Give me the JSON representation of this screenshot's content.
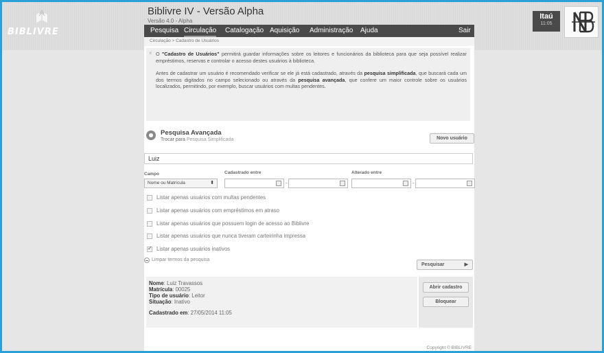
{
  "app": {
    "logo_text": "BIBLIVRE",
    "title": "Biblivre IV - Versão Alpha",
    "version": "Versão 4.0 - Alpha"
  },
  "nav": {
    "items": [
      "Pesquisa",
      "Circulação",
      "Catalogação",
      "Aquisição",
      "Administração",
      "Ajuda"
    ],
    "active": "Circulação",
    "logout": "Sair"
  },
  "breadcrumb": "Circulação > Cadastro de Usuários",
  "bank": {
    "name": "Itaú",
    "time": "11:05"
  },
  "info": {
    "p1_pre": "O ",
    "p1_bold": "\"Cadastro de Usuários\"",
    "p1_post": " permitirá guardar informações sobre os leitores e funcionários da biblioteca para que seja possível realizar empréstimos, reservas e controlar o acesso destes usuários à biblioteca.",
    "p2_a": "Antes de cadastrar um usuário é recomendado verificar se ele já está cadastrado, através da ",
    "p2_b": "pesquisa simplificada",
    "p2_c": ", que buscará cada um dos termos digitados no campo selecionado ou através da ",
    "p2_d": "pesquisa avançada",
    "p2_e": ", que confere um maior controle sobre os usuários localizados, permitindo, por exemplo, buscar usuários com multas pendentes."
  },
  "search": {
    "title": "Pesquisa Avançada",
    "switch_prefix": "Trocar para ",
    "switch_link": "Pesquisa Simplificada",
    "new_user_button": "Novo usuário",
    "query": "Luiz",
    "field_label": "Campo",
    "field_value": "Nome ou Matrícula",
    "created_label": "Cadastrado entre",
    "changed_label": "Alterado entre",
    "created_from": "",
    "created_to": "",
    "changed_from": "",
    "changed_to": "",
    "filters": [
      {
        "label": "Listar apenas usuários com multas pendentes",
        "checked": false
      },
      {
        "label": "Listar apenas usuários com empréstimos em atraso",
        "checked": false
      },
      {
        "label": "Listar apenas usuários que possuem login de acesso ao Biblivre",
        "checked": false
      },
      {
        "label": "Listar apenas usuários que nunca tiveram carteirinha impressa",
        "checked": false
      },
      {
        "label": "Listar apenas usuários inativos",
        "checked": true
      }
    ],
    "clear_label": "Limpar termos da pesquisa",
    "search_button": "Pesquisar"
  },
  "result": {
    "name_label": "Nome",
    "name": ": Luiz Travassos",
    "reg_label": "Matrícula",
    "reg": ": 00025",
    "type_label": "Tipo de usuário",
    "type": ": Leitor",
    "status_label": "Situação",
    "status": ": Inativo",
    "created_label": "Cadastrado em",
    "created": ": 27/05/2014 11:05",
    "open_button": "Abrir cadastro",
    "block_button": "Bloquear"
  },
  "footer": "Copyright © BIBLIVRE"
}
